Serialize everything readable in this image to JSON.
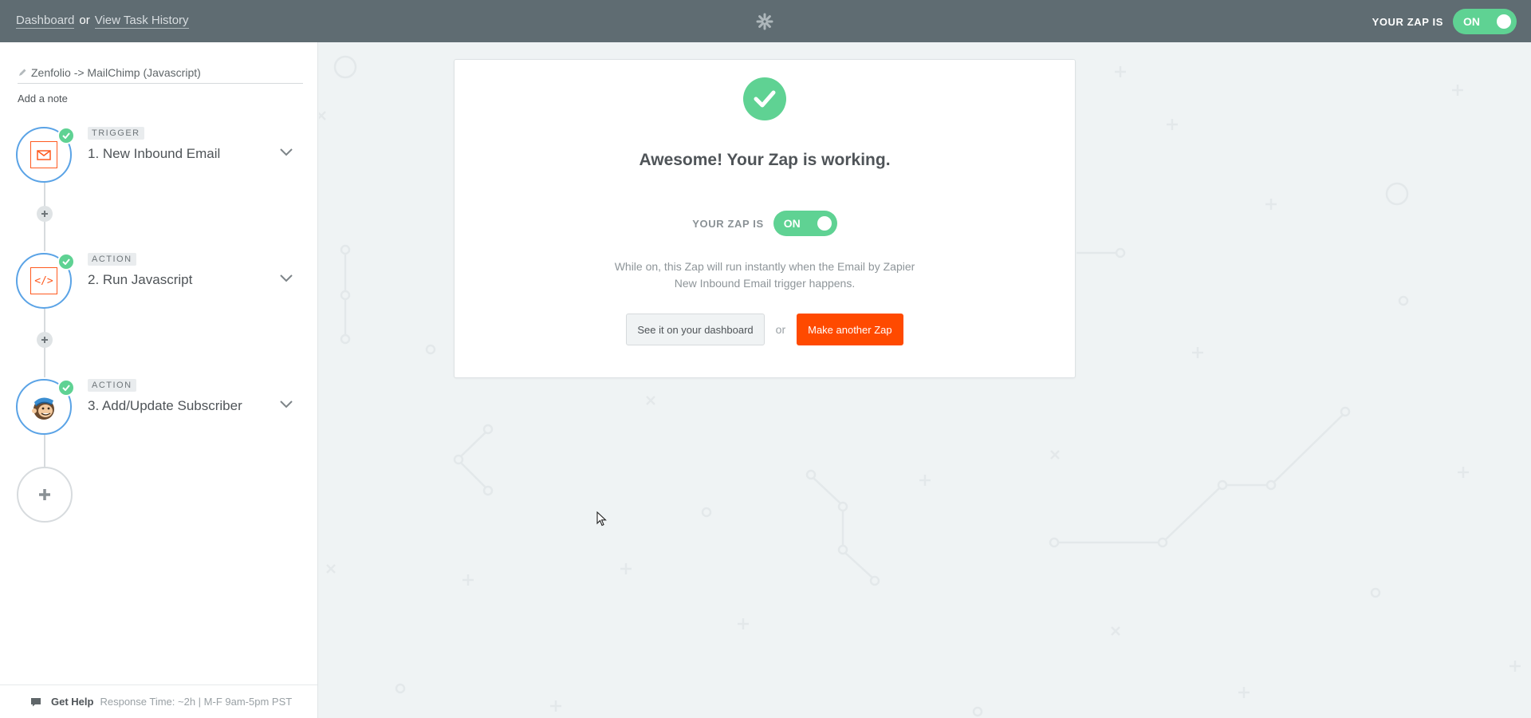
{
  "topbar": {
    "dashboard_link": "Dashboard",
    "or_text": "or",
    "task_history_link": "View Task History",
    "logo_icon": "zapier-asterisk-icon",
    "status_label": "YOUR ZAP IS",
    "toggle_state": "ON"
  },
  "sidebar": {
    "zap_name": "Zenfolio -> MailChimp (Javascript)",
    "add_note": "Add a note",
    "steps": [
      {
        "badge": "TRIGGER",
        "title": "1. New Inbound Email",
        "icon": "email-icon",
        "status": "complete"
      },
      {
        "badge": "ACTION",
        "title": "2. Run Javascript",
        "icon": "code-icon",
        "status": "complete"
      },
      {
        "badge": "ACTION",
        "title": "3. Add/Update Subscriber",
        "icon": "mailchimp-logo-icon",
        "status": "complete"
      }
    ],
    "code_glyph": "</>",
    "help": {
      "label": "Get Help",
      "response": "Response Time: ~2h | M-F 9am-5pm PST"
    }
  },
  "card": {
    "headline": "Awesome! Your Zap is working.",
    "status_label": "YOUR ZAP IS",
    "toggle_state": "ON",
    "description_line1": "While on, this Zap will run instantly when the Email by Zapier",
    "description_line2": "New Inbound Email trigger happens.",
    "secondary_button": "See it on your dashboard",
    "or_text": "or",
    "primary_button": "Make another Zap"
  },
  "colors": {
    "topbar": "#5f6c72",
    "success_green": "#5fd293",
    "primary_orange": "#ff4a00",
    "step_ring_blue": "#5aa3e6",
    "background": "#eff3f4"
  }
}
